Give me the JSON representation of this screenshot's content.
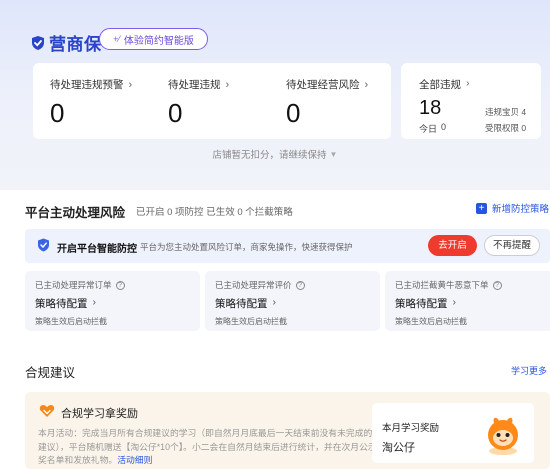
{
  "brand": {
    "name": "营商保",
    "trial_button": "体验简约智能版"
  },
  "stats": [
    {
      "label": "待处理违规预警",
      "value": "0"
    },
    {
      "label": "待处理违规",
      "value": "0"
    },
    {
      "label": "待处理经营风险",
      "value": "0"
    }
  ],
  "all_violations": {
    "label": "全部违规",
    "value": "18",
    "today_label": "今日",
    "today_value": "0",
    "goods_label": "违规宝贝",
    "goods_value": "4",
    "restricted_label": "受限权限",
    "restricted_value": "0"
  },
  "shop_note": "店铺暂无扣分，请继续保持",
  "platform": {
    "title": "平台主动处理风险",
    "subtitle": "已开启 0 项防控 已生效 0 个拦截策略",
    "add_policy": "新增防控策略",
    "banner_title": "开启平台智能防控",
    "banner_desc": "平台为您主动处置风险订单，商家免操作，快速获得保护",
    "go_open": "去开启",
    "no_remind": "不再提醒",
    "cards": [
      {
        "title": "已主动处理异常订单",
        "status": "策略待配置",
        "note": "策略生效后启动拦截"
      },
      {
        "title": "已主动处理异常评价",
        "status": "策略待配置",
        "note": "策略生效后启动拦截"
      },
      {
        "title": "已主动拦截黄牛恶意下单",
        "status": "策略待配置",
        "note": "策略生效后启动拦截"
      }
    ]
  },
  "compliance": {
    "title": "合规建议",
    "learn_more": "学习更多",
    "reward_title": "合规学习拿奖励",
    "reward_desc": "本月活动：完成当月所有合规建议的学习（即自然月月底最后一天结束前没有未完成的学习建议），平台随机赠送【淘公仔*10个】。小二会在自然月结束后进行统计，并在次月公示中奖名单和发放礼物。",
    "rule_link": "活动细则",
    "month_label": "本月学习奖励",
    "month_prize": "淘公仔"
  },
  "colors": {
    "brand_blue": "#2a44c9",
    "accent_red": "#ef3b2d",
    "link_blue": "#2855e0",
    "purple": "#7a5cf0"
  },
  "icons": {
    "brand": "shield-check-icon",
    "banner": "shield-icon",
    "reward": "heart-icon",
    "mascot": "taobao-mascot-icon"
  }
}
